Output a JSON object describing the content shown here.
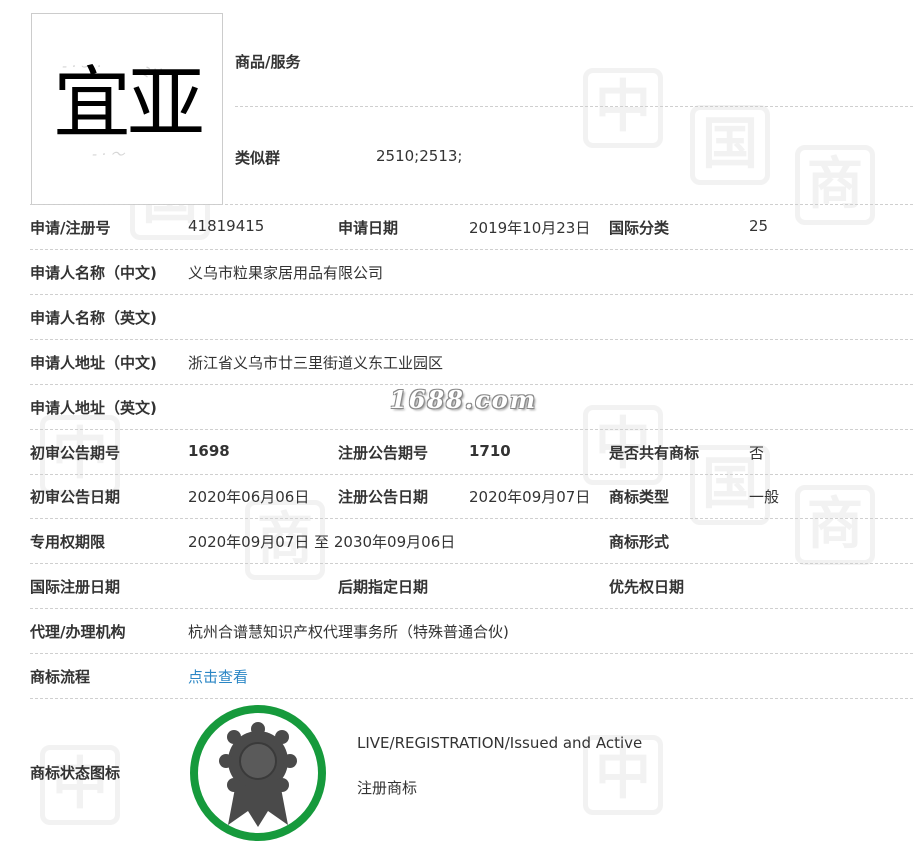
{
  "logo": {
    "text": "宜亚"
  },
  "watermark": {
    "site": "1688.com",
    "char": "中",
    "char2": "国",
    "char3": "商"
  },
  "goods": {
    "label": "商品/服务",
    "value": ""
  },
  "similar": {
    "label": "类似群",
    "value": "2510;2513;"
  },
  "rows": {
    "reg_no": {
      "label": "申请/注册号",
      "value": "41819415"
    },
    "app_date": {
      "label": "申请日期",
      "value": "2019年10月23日"
    },
    "intl_class": {
      "label": "国际分类",
      "value": "25"
    },
    "applicant_cn": {
      "label": "申请人名称（中文)",
      "value": "义乌市粒果家居用品有限公司"
    },
    "applicant_en": {
      "label": "申请人名称（英文)",
      "value": ""
    },
    "address_cn": {
      "label": "申请人地址（中文)",
      "value": "浙江省义乌市廿三里街道义东工业园区"
    },
    "address_en": {
      "label": "申请人地址（英文)",
      "value": ""
    },
    "prelim_issue": {
      "label": "初审公告期号",
      "value": "1698"
    },
    "reg_issue": {
      "label": "注册公告期号",
      "value": "1710"
    },
    "shared": {
      "label": "是否共有商标",
      "value": "否"
    },
    "prelim_date": {
      "label": "初审公告日期",
      "value": "2020年06月06日"
    },
    "reg_date": {
      "label": "注册公告日期",
      "value": "2020年09月07日"
    },
    "tm_type": {
      "label": "商标类型",
      "value": "一般"
    },
    "exclusive": {
      "label": "专用权期限",
      "value": "2020年09月07日 至 2030年09月06日"
    },
    "tm_form": {
      "label": "商标形式",
      "value": ""
    },
    "intl_reg_date": {
      "label": "国际注册日期",
      "value": ""
    },
    "later_date": {
      "label": "后期指定日期",
      "value": ""
    },
    "priority_date": {
      "label": "优先权日期",
      "value": ""
    },
    "agent": {
      "label": "代理/办理机构",
      "value": "杭州合谱慧知识产权代理事务所（特殊普通合伙)"
    },
    "flow": {
      "label": "商标流程",
      "value": "点击查看"
    },
    "status_icon": {
      "label": "商标状态图标"
    }
  },
  "status": {
    "en": "LIVE/REGISTRATION/Issued and Active",
    "cn": "注册商标"
  },
  "colors": {
    "link": "#2a86c5",
    "seal_ring": "#169a3c",
    "seal_badge": "#4a4a4a"
  }
}
